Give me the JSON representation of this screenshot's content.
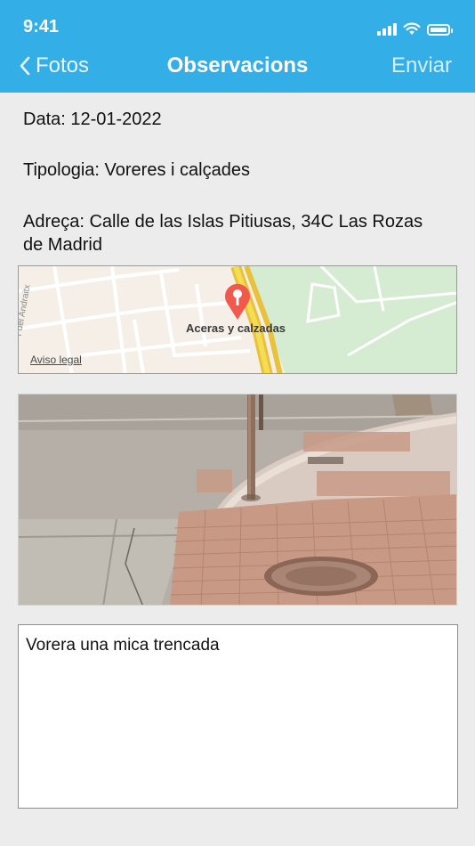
{
  "status_bar": {
    "time": "9:41"
  },
  "nav": {
    "back_label": "Fotos",
    "title": "Observacions",
    "send_label": "Enviar"
  },
  "details": {
    "date": "Data: 12-01-2022",
    "type": "Tipologia: Voreres i calçades",
    "address_line1": "Adreça: Calle de las Islas Pitiusas, 34C Las Rozas",
    "address_line2": "de Madrid"
  },
  "map": {
    "pin_label": "Aceras y calzadas",
    "legal_link": "Aviso legal",
    "street_label": "r del Andraitx",
    "pin_color": "#f0594c"
  },
  "photo": {},
  "notes": {
    "text": "Vorera una mica trencada"
  },
  "colors": {
    "header": "#34aee6",
    "background": "#ececec"
  }
}
